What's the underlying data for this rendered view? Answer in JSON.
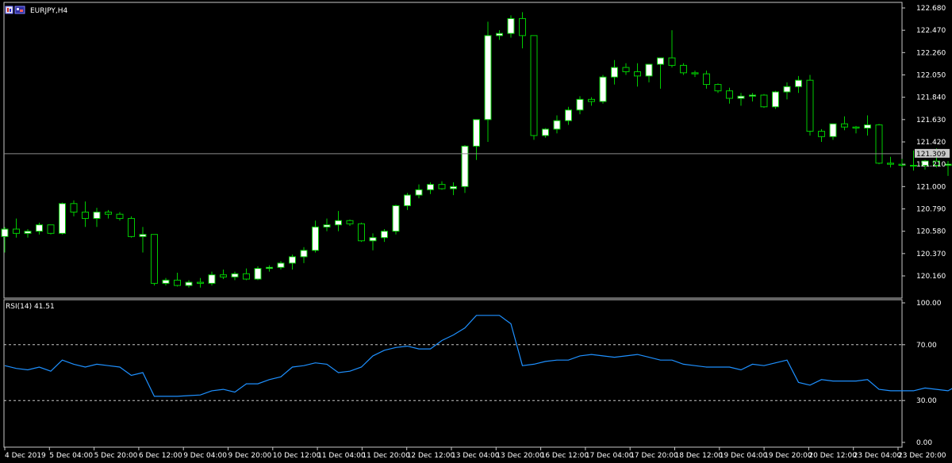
{
  "window": {
    "symbol_title": "EURJPY,H4",
    "rsi_title": "RSI(14) 41.51",
    "current_price_label": "121.309",
    "colors": {
      "background": "#000000",
      "frame": "#c8c8c8",
      "bull_fill": "#ffffff",
      "bear_fill": "#000000",
      "candle_outline": "#00cc00",
      "wick": "#00cc00",
      "rsi_line": "#1e90ff",
      "level_line": "#c8c8c8",
      "text": "#ffffff",
      "price_tag_bg": "#c8c8c8",
      "price_tag_text": "#000000"
    }
  },
  "chart_data": [
    {
      "type": "candlestick",
      "symbol": "EURJPY",
      "timeframe": "H4",
      "ylim": [
        120.0,
        122.68
      ],
      "y_ticks": [
        "122.680",
        "122.470",
        "122.260",
        "122.050",
        "121.840",
        "121.630",
        "121.420",
        "121.210",
        "121.000",
        "120.790",
        "120.580",
        "120.370",
        "120.160"
      ],
      "current_price": 121.309,
      "x_tick_labels": [
        "4 Dec 2019",
        "5 Dec 04:00",
        "5 Dec 20:00",
        "6 Dec 12:00",
        "9 Dec 04:00",
        "9 Dec 20:00",
        "10 Dec 12:00",
        "11 Dec 04:00",
        "11 Dec 20:00",
        "12 Dec 12:00",
        "13 Dec 04:00",
        "13 Dec 20:00",
        "16 Dec 12:00",
        "17 Dec 04:00",
        "17 Dec 20:00",
        "18 Dec 12:00",
        "19 Dec 04:00",
        "19 Dec 20:00",
        "20 Dec 12:00",
        "23 Dec 04:00",
        "23 Dec 20:00"
      ],
      "ohlc": [
        [
          120.53,
          120.62,
          120.38,
          120.6
        ],
        [
          120.6,
          120.7,
          120.52,
          120.56
        ],
        [
          120.56,
          120.6,
          120.52,
          120.58
        ],
        [
          120.58,
          120.66,
          120.55,
          120.64
        ],
        [
          120.64,
          120.64,
          120.55,
          120.56
        ],
        [
          120.56,
          120.85,
          120.55,
          120.84
        ],
        [
          120.84,
          120.87,
          120.72,
          120.76
        ],
        [
          120.76,
          120.86,
          120.62,
          120.7
        ],
        [
          120.7,
          120.8,
          120.62,
          120.76
        ],
        [
          120.76,
          120.78,
          120.7,
          120.74
        ],
        [
          120.74,
          120.76,
          120.68,
          120.7
        ],
        [
          120.7,
          120.72,
          120.52,
          120.53
        ],
        [
          120.53,
          120.62,
          120.38,
          120.55
        ],
        [
          120.55,
          120.55,
          120.07,
          120.09
        ],
        [
          120.09,
          120.14,
          120.07,
          120.12
        ],
        [
          120.12,
          120.19,
          120.06,
          120.07
        ],
        [
          120.07,
          120.12,
          120.05,
          120.1
        ],
        [
          120.1,
          120.14,
          120.05,
          120.09
        ],
        [
          120.09,
          120.2,
          120.07,
          120.17
        ],
        [
          120.17,
          120.22,
          120.13,
          120.15
        ],
        [
          120.15,
          120.2,
          120.12,
          120.18
        ],
        [
          120.18,
          120.23,
          120.12,
          120.13
        ],
        [
          120.13,
          120.25,
          120.12,
          120.23
        ],
        [
          120.23,
          120.26,
          120.2,
          120.24
        ],
        [
          120.24,
          120.3,
          120.22,
          120.28
        ],
        [
          120.28,
          120.36,
          120.22,
          120.34
        ],
        [
          120.34,
          120.43,
          120.28,
          120.4
        ],
        [
          120.4,
          120.68,
          120.38,
          120.62
        ],
        [
          120.62,
          120.7,
          120.58,
          120.64
        ],
        [
          120.64,
          120.77,
          120.58,
          120.68
        ],
        [
          120.68,
          120.69,
          120.63,
          120.65
        ],
        [
          120.65,
          120.66,
          120.48,
          120.49
        ],
        [
          120.49,
          120.56,
          120.4,
          120.52
        ],
        [
          120.52,
          120.6,
          120.48,
          120.58
        ],
        [
          120.58,
          120.83,
          120.55,
          120.82
        ],
        [
          120.82,
          120.94,
          120.78,
          120.92
        ],
        [
          120.92,
          121.02,
          120.89,
          120.97
        ],
        [
          120.97,
          121.04,
          120.93,
          121.02
        ],
        [
          121.02,
          121.05,
          120.97,
          120.98
        ],
        [
          120.98,
          121.04,
          120.92,
          121.0
        ],
        [
          121.0,
          121.39,
          120.94,
          121.38
        ],
        [
          121.38,
          121.63,
          121.25,
          121.63
        ],
        [
          121.63,
          122.55,
          121.42,
          122.42
        ],
        [
          122.42,
          122.47,
          122.38,
          122.44
        ],
        [
          122.44,
          122.61,
          122.4,
          122.58
        ],
        [
          122.58,
          122.64,
          122.3,
          122.42
        ],
        [
          122.42,
          122.42,
          121.44,
          121.48
        ],
        [
          121.48,
          121.55,
          121.46,
          121.54
        ],
        [
          121.54,
          121.67,
          121.5,
          121.62
        ],
        [
          121.62,
          121.75,
          121.58,
          121.72
        ],
        [
          121.72,
          121.85,
          121.68,
          121.82
        ],
        [
          121.82,
          121.84,
          121.76,
          121.8
        ],
        [
          121.8,
          122.05,
          121.78,
          122.03
        ],
        [
          122.03,
          122.19,
          121.96,
          122.12
        ],
        [
          122.12,
          122.16,
          122.05,
          122.08
        ],
        [
          122.08,
          122.16,
          121.94,
          122.04
        ],
        [
          122.04,
          122.15,
          121.98,
          122.15
        ],
        [
          122.15,
          122.2,
          121.92,
          122.21
        ],
        [
          122.21,
          122.47,
          122.12,
          122.14
        ],
        [
          122.14,
          122.16,
          122.05,
          122.07
        ],
        [
          122.07,
          122.09,
          122.03,
          122.06
        ],
        [
          122.06,
          122.09,
          121.92,
          121.96
        ],
        [
          121.96,
          121.97,
          121.88,
          121.9
        ],
        [
          121.9,
          121.93,
          121.78,
          121.83
        ],
        [
          121.83,
          121.88,
          121.76,
          121.85
        ],
        [
          121.85,
          121.88,
          121.8,
          121.86
        ],
        [
          121.86,
          121.87,
          121.74,
          121.75
        ],
        [
          121.75,
          121.9,
          121.73,
          121.89
        ],
        [
          121.89,
          121.98,
          121.82,
          121.94
        ],
        [
          121.94,
          122.04,
          121.88,
          122.0
        ],
        [
          122.0,
          122.05,
          121.48,
          121.52
        ],
        [
          121.52,
          121.54,
          121.42,
          121.47
        ],
        [
          121.47,
          121.59,
          121.44,
          121.59
        ],
        [
          121.59,
          121.66,
          121.53,
          121.56
        ],
        [
          121.56,
          121.57,
          121.5,
          121.55
        ],
        [
          121.55,
          121.67,
          121.48,
          121.58
        ],
        [
          121.58,
          121.59,
          121.21,
          121.22
        ],
        [
          121.22,
          121.28,
          121.18,
          121.21
        ],
        [
          121.21,
          121.26,
          121.18,
          121.2
        ],
        [
          121.2,
          121.34,
          121.15,
          121.2
        ],
        [
          121.2,
          121.25,
          121.16,
          121.24
        ],
        [
          121.24,
          121.36,
          121.18,
          121.2
        ],
        [
          121.2,
          121.24,
          121.1,
          121.21
        ],
        [
          121.21,
          121.33,
          121.18,
          121.31
        ],
        [
          121.31,
          121.33,
          121.29,
          121.31
        ]
      ]
    },
    {
      "type": "line",
      "title": "RSI(14) 41.51",
      "ylim": [
        0,
        100
      ],
      "y_ticks": [
        "100.00",
        "70.00",
        "30.00",
        "0.00"
      ],
      "levels": [
        70,
        30
      ],
      "series": [
        {
          "name": "RSI(14)",
          "values": [
            55,
            53,
            52,
            54,
            51,
            59,
            56,
            54,
            56,
            55,
            54,
            48,
            50,
            33,
            33,
            33,
            33.5,
            34,
            37,
            38,
            36,
            42,
            42,
            45,
            47,
            54,
            55,
            57,
            56,
            50,
            51,
            54,
            62,
            66,
            68,
            69,
            67,
            67,
            73,
            77,
            82,
            91,
            91,
            91,
            85,
            55,
            56,
            58,
            59,
            59,
            62,
            63,
            62,
            61,
            62,
            63,
            61,
            59,
            59,
            56,
            55,
            54,
            54,
            54,
            52,
            56,
            55,
            57,
            59,
            43,
            41,
            45,
            44,
            44,
            44,
            45,
            38,
            37,
            37,
            37,
            39,
            38,
            37,
            41.5,
            41.5
          ]
        }
      ]
    }
  ]
}
